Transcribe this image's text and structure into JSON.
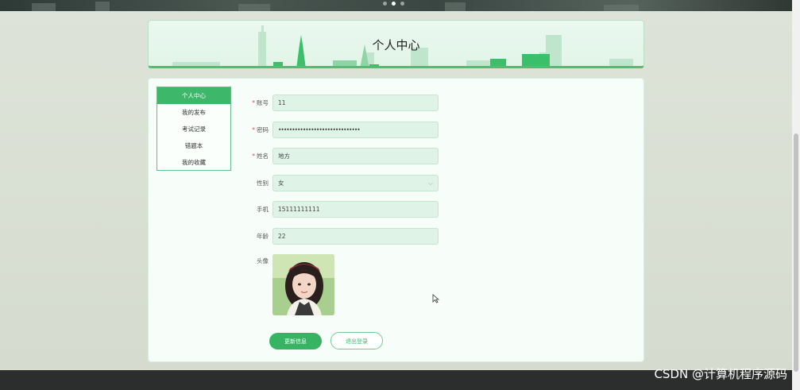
{
  "header": {
    "title": "个人中心"
  },
  "sidebar": {
    "items": [
      {
        "label": "个人中心",
        "active": true
      },
      {
        "label": "我的发布",
        "active": false
      },
      {
        "label": "考试记录",
        "active": false
      },
      {
        "label": "错题本",
        "active": false
      },
      {
        "label": "我的收藏",
        "active": false
      }
    ]
  },
  "form": {
    "account": {
      "label": "账号",
      "required": "*",
      "value": "11"
    },
    "password": {
      "label": "密码",
      "required": "*",
      "value": "••••••••••••••••••••••••••••••"
    },
    "name": {
      "label": "姓名",
      "required": "*",
      "value": "地方"
    },
    "gender": {
      "label": "性别",
      "value": "女",
      "icon": "chevron-down-icon"
    },
    "phone": {
      "label": "手机",
      "value": "15111111111"
    },
    "age": {
      "label": "年龄",
      "value": "22"
    },
    "avatar": {
      "label": "头像"
    }
  },
  "actions": {
    "update_label": "更新信息",
    "logout_label": "退出登录"
  },
  "footer": {
    "watermark": "CSDN @计算机程序源码"
  },
  "colors": {
    "accent": "#3db86a",
    "field_bg": "#dff3e6",
    "required": "#e04b4b"
  }
}
